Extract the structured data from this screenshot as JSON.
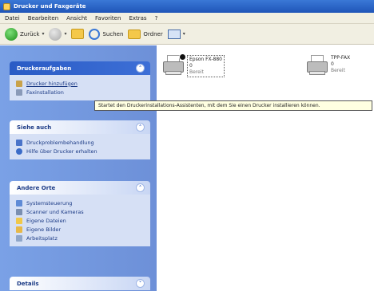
{
  "window": {
    "title": "Drucker und Faxgeräte"
  },
  "menu": [
    "Datei",
    "Bearbeiten",
    "Ansicht",
    "Favoriten",
    "Extras",
    "?"
  ],
  "toolbar": {
    "back": "Zurück",
    "search": "Suchen",
    "folders": "Ordner"
  },
  "sidebar": {
    "tasks": {
      "title": "Druckeraufgaben",
      "items": [
        "Drucker hinzufügen",
        "Faxinstallation"
      ]
    },
    "see_also": {
      "title": "Siehe auch",
      "items": [
        "Druckproblembehandlung",
        "Hilfe über Drucker erhalten"
      ]
    },
    "other_places": {
      "title": "Andere Orte",
      "items": [
        "Systemsteuerung",
        "Scanner und Kameras",
        "Eigene Dateien",
        "Eigene Bilder",
        "Arbeitsplatz"
      ]
    },
    "details": {
      "title": "Details"
    }
  },
  "printers": [
    {
      "name": "Epson FX-880",
      "jobs": "0",
      "status": "Bereit"
    },
    {
      "name": "TPP-FAX",
      "jobs": "0",
      "status": "Bereit"
    }
  ],
  "tooltip": "Startet den Druckerinstallations-Assistenten, mit dem Sie einen Drucker installieren können."
}
